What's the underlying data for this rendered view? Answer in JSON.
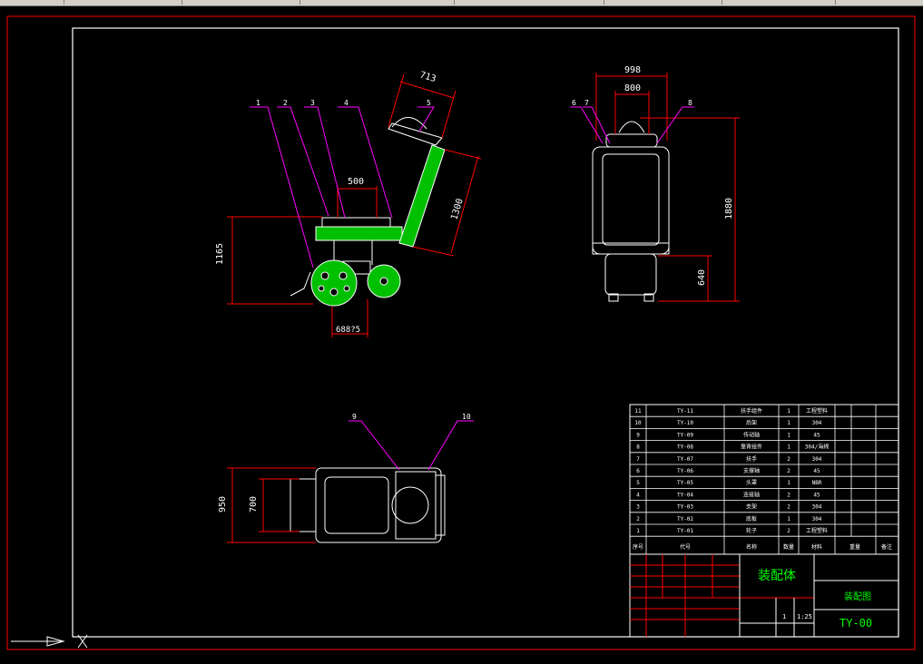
{
  "views": {
    "side": {
      "dims": {
        "seat_width": "500",
        "height_total": "1165",
        "handle_len": "1300",
        "handle_top": "713",
        "wheelbase": "688?5"
      },
      "callouts": [
        "1",
        "2",
        "3",
        "4",
        "5"
      ]
    },
    "front": {
      "dims": {
        "outer_width": "998",
        "inner_width": "800",
        "height": "1880",
        "lower_height": "640"
      },
      "callouts": [
        "6",
        "7",
        "8"
      ]
    },
    "top": {
      "dims": {
        "outer": "950",
        "inner": "700"
      },
      "callouts": [
        "9",
        "10"
      ]
    }
  },
  "bom": {
    "rows": [
      {
        "no": "11",
        "code": "TY-11",
        "name": "扶手组件",
        "qty": "1",
        "material": "工程塑料"
      },
      {
        "no": "10",
        "code": "TY-10",
        "name": "后架",
        "qty": "1",
        "material": "304"
      },
      {
        "no": "9",
        "code": "TY-09",
        "name": "传动轴",
        "qty": "1",
        "material": "45"
      },
      {
        "no": "8",
        "code": "TY-08",
        "name": "靠背组件",
        "qty": "1",
        "material": "304/海绵"
      },
      {
        "no": "7",
        "code": "TY-07",
        "name": "扶手",
        "qty": "2",
        "material": "304"
      },
      {
        "no": "6",
        "code": "TY-06",
        "name": "支撑轴",
        "qty": "2",
        "material": "45"
      },
      {
        "no": "5",
        "code": "TY-05",
        "name": "头罩",
        "qty": "1",
        "material": "NBR"
      },
      {
        "no": "4",
        "code": "TY-04",
        "name": "连接轴",
        "qty": "2",
        "material": "45"
      },
      {
        "no": "3",
        "code": "TY-03",
        "name": "支架",
        "qty": "2",
        "material": "304"
      },
      {
        "no": "2",
        "code": "TY-02",
        "name": "底板",
        "qty": "1",
        "material": "304"
      },
      {
        "no": "1",
        "code": "TY-01",
        "name": "轮子",
        "qty": "2",
        "material": "工程塑料"
      }
    ],
    "header": {
      "no": "序号",
      "code": "代号",
      "name": "名称",
      "qty": "数量",
      "material": "材料",
      "weight": "重量",
      "remark": "备注"
    }
  },
  "title_block": {
    "assembly_name": "装配体",
    "drawing_type": "装配图",
    "drawing_no": "TY-00",
    "scale": "1:25",
    "sheet": "1"
  },
  "colors": {
    "frame": "#ff0000",
    "line": "#ffffff",
    "dim": "#ff0000",
    "hatch": "#00c000",
    "leader": "#ff00ff",
    "text": "#ffffff",
    "green_text": "#00ff00"
  }
}
